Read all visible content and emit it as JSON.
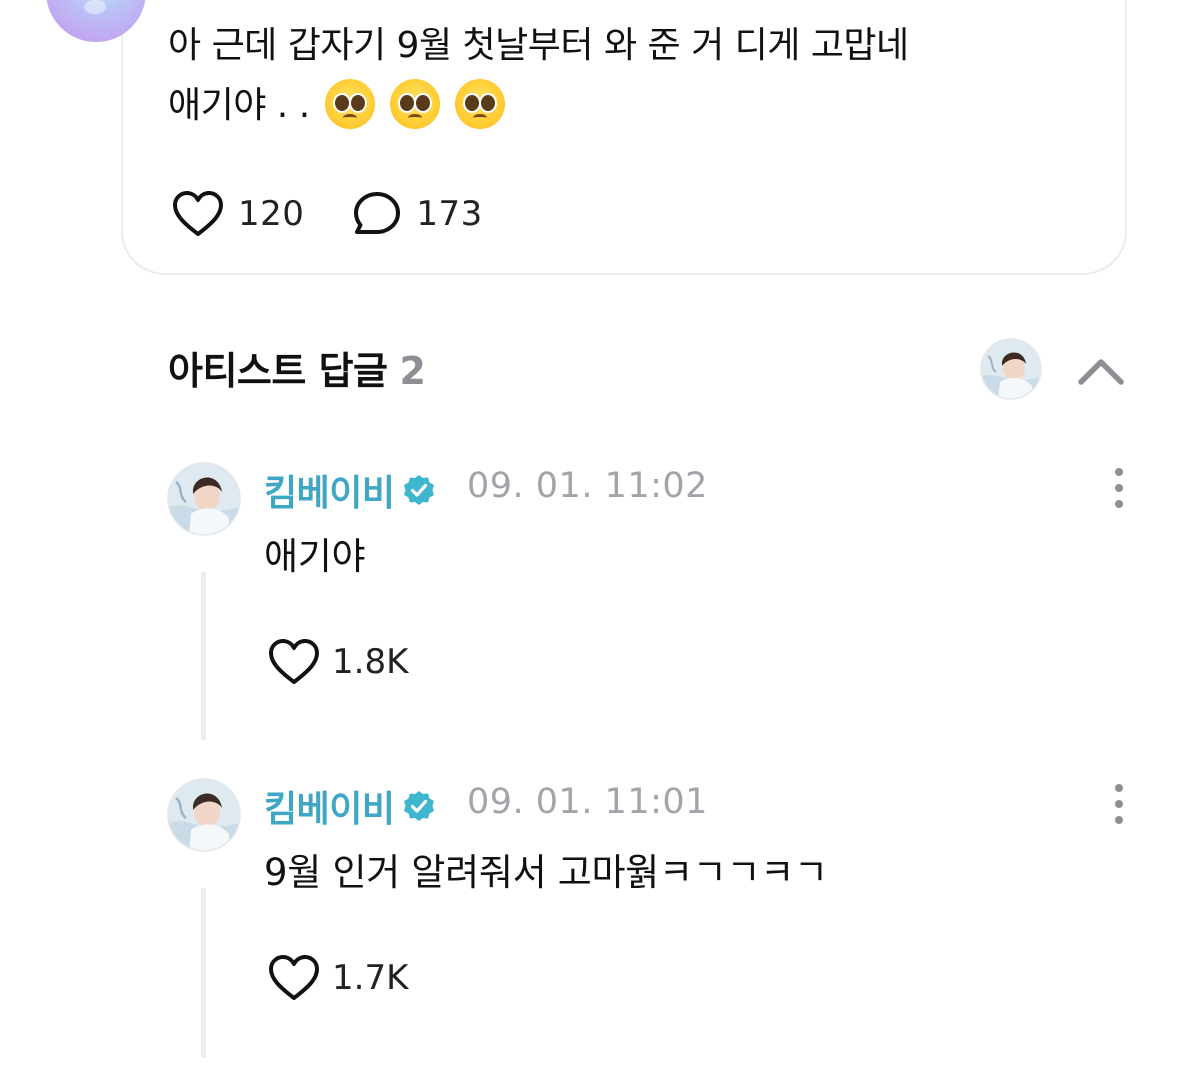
{
  "post": {
    "text_line1": "아 근데 갑자기 9월 첫날부터 와 준 거 디게 고맙네",
    "text_line2": "애기야 . .",
    "emojis": [
      "pleading-face",
      "pleading-face",
      "pleading-face"
    ],
    "like_count": "120",
    "comment_count": "173"
  },
  "artist_replies": {
    "title": "아티스트 답글",
    "count": "2",
    "items": [
      {
        "author": "킴베이비",
        "verified": true,
        "timestamp": "09. 01. 11:02",
        "text": "애기야",
        "like_count": "1.8K"
      },
      {
        "author": "킴베이비",
        "verified": true,
        "timestamp": "09. 01. 11:01",
        "text": "9월 인거 알려줘서 고마웕ㅋㄱㄱㅋㄱ",
        "like_count": "1.7K"
      }
    ]
  },
  "colors": {
    "author_name": "#3fa7c6",
    "verified_badge": "#3fb6d0",
    "timestamp": "#a3a3aa",
    "reply_count": "#8e8e95",
    "card_border": "#ececf1"
  }
}
